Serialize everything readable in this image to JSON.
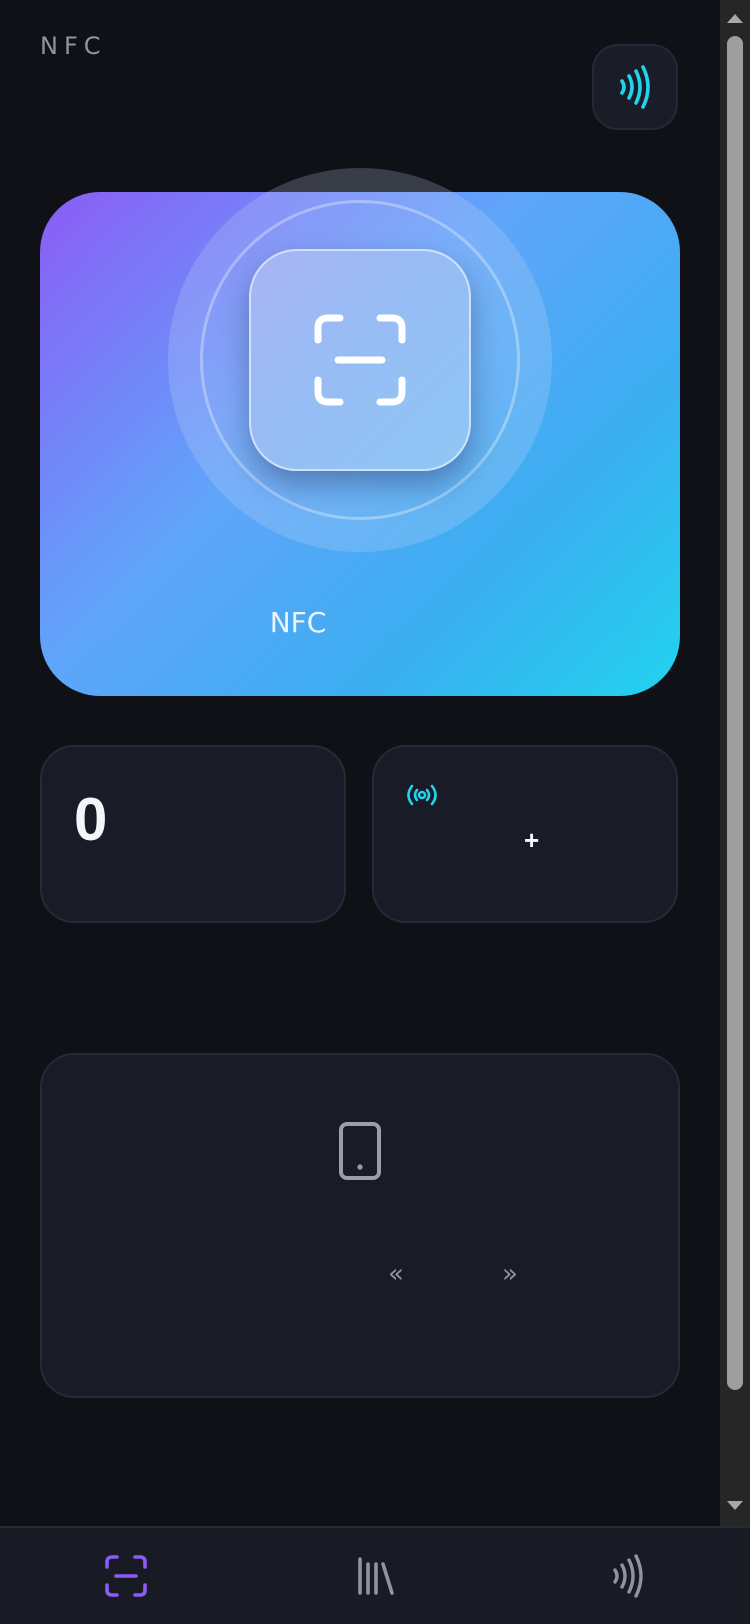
{
  "header": {
    "title": "NFC"
  },
  "hero": {
    "label": "NFC"
  },
  "stats": {
    "count": "0",
    "add_label": "+"
  },
  "panel": {
    "prev": "«",
    "next": "»"
  },
  "colors": {
    "background": "#0f1117",
    "card": "#191b26",
    "accent_purple": "#8b5cf6",
    "accent_cyan": "#22d3ee"
  },
  "icons": {
    "header_button": "nfc-wave-icon",
    "scan": "scan-frame-icon",
    "signal": "signal-broadcast-icon",
    "device": "smartphone-icon",
    "tab_scan": "scan-frame-icon",
    "tab_library": "library-icon",
    "tab_nfc": "nfc-wave-icon"
  }
}
